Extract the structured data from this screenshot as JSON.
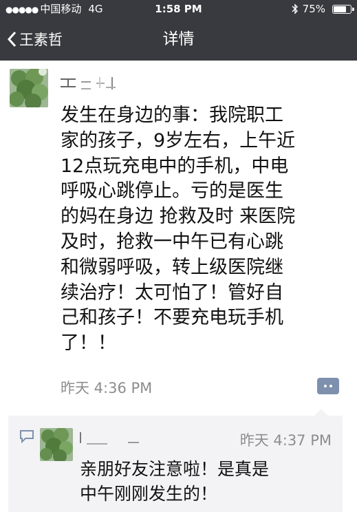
{
  "status_bar": {
    "signal": "●●●●●",
    "carrier": "中国移动",
    "network": "4G",
    "time": "1:58 PM",
    "battery": "75%",
    "battery_fraction": 0.75
  },
  "nav": {
    "back_label": "王素哲",
    "title": "详情"
  },
  "post": {
    "text": "发生在身边的事：我院职工\n家的孩子，9岁左右，上午近\n12点玩充电中的手机，中电\n呼吸心跳停止。亏的是医生\n的妈在身边 抢救及时 来医院\n及时，抢救一中午已有心跳\n和微弱呼吸，转上级医院继\n续治疗！太可怕了！管好自\n己和孩子！不要充电玩手机\n了！！",
    "time": "昨天 4:36 PM"
  },
  "reply": {
    "time": "昨天 4:37 PM",
    "text": "亲朋好友注意啦！是真是\n中午刚刚发生的！"
  },
  "colors": {
    "nav_bg": "#393a3f",
    "comment_button": "#7d90ad",
    "comment_bg": "#f3f3f5",
    "meta_text": "#8d8d8d"
  },
  "icons": [
    "bluetooth-icon",
    "battery-icon",
    "back-chevron-icon",
    "comment-icon",
    "comment-bubble-icon"
  ]
}
